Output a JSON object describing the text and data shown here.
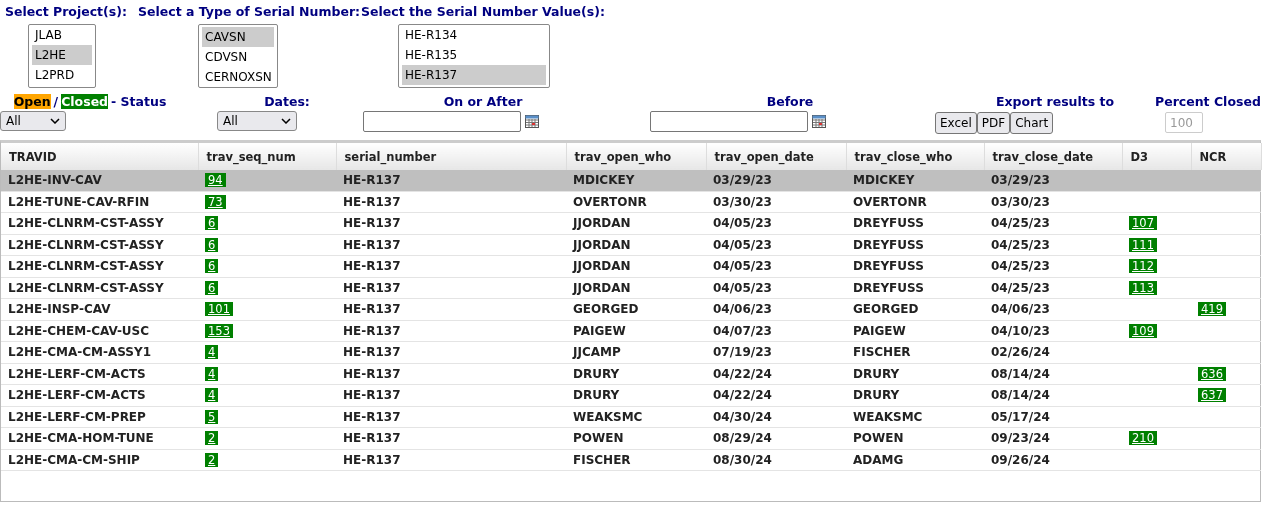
{
  "selectors": [
    {
      "label": "Select Project(s):",
      "items": [
        {
          "text": "JLAB",
          "selected": false
        },
        {
          "text": "L2HE",
          "selected": true
        },
        {
          "text": "L2PRD",
          "selected": false
        }
      ]
    },
    {
      "label": "Select a Type of Serial Number:",
      "items": [
        {
          "text": "CAVSN",
          "selected": true
        },
        {
          "text": "CDVSN",
          "selected": false
        },
        {
          "text": "CERNOXSN",
          "selected": false
        }
      ]
    },
    {
      "label": "Select the Serial Number Value(s):",
      "items": [
        {
          "text": "HE-R134",
          "selected": false
        },
        {
          "text": "HE-R135",
          "selected": false
        },
        {
          "text": "HE-R137",
          "selected": true
        }
      ]
    }
  ],
  "status": {
    "open": "Open",
    "slash": "/",
    "closed": "Closed",
    "suffix": "- Status",
    "value": "All"
  },
  "dates": {
    "label": "Dates:",
    "value": "All"
  },
  "on_or_after": {
    "label": "On or After"
  },
  "before": {
    "label": "Before"
  },
  "export": {
    "label": "Export results to",
    "buttons": [
      "Excel",
      "PDF",
      "Chart"
    ]
  },
  "percent_closed": {
    "label": "Percent Closed",
    "value": "100",
    "disabled": true
  },
  "table": {
    "columns": [
      "TRAVID",
      "trav_seq_num",
      "serial_number",
      "trav_open_who",
      "trav_open_date",
      "trav_close_who",
      "trav_close_date",
      "D3",
      "NCR"
    ],
    "rows": [
      {
        "selected": true,
        "travid": "L2HE-INV-CAV",
        "seq": "94",
        "serial": "HE-R137",
        "open_who": "MDICKEY",
        "open_date": "03/29/23",
        "close_who": "MDICKEY",
        "close_date": "03/29/23"
      },
      {
        "selected": false,
        "travid": "L2HE-TUNE-CAV-RFIN",
        "seq": "73",
        "serial": "HE-R137",
        "open_who": "OVERTONR",
        "open_date": "03/30/23",
        "close_who": "OVERTONR",
        "close_date": "03/30/23"
      },
      {
        "selected": false,
        "travid": "L2HE-CLNRM-CST-ASSY",
        "seq": "6",
        "serial": "HE-R137",
        "open_who": "JJORDAN",
        "open_date": "04/05/23",
        "close_who": "DREYFUSS",
        "close_date": "04/25/23",
        "d3": "107"
      },
      {
        "selected": false,
        "travid": "L2HE-CLNRM-CST-ASSY",
        "seq": "6",
        "serial": "HE-R137",
        "open_who": "JJORDAN",
        "open_date": "04/05/23",
        "close_who": "DREYFUSS",
        "close_date": "04/25/23",
        "d3": "111"
      },
      {
        "selected": false,
        "travid": "L2HE-CLNRM-CST-ASSY",
        "seq": "6",
        "serial": "HE-R137",
        "open_who": "JJORDAN",
        "open_date": "04/05/23",
        "close_who": "DREYFUSS",
        "close_date": "04/25/23",
        "d3": "112"
      },
      {
        "selected": false,
        "travid": "L2HE-CLNRM-CST-ASSY",
        "seq": "6",
        "serial": "HE-R137",
        "open_who": "JJORDAN",
        "open_date": "04/05/23",
        "close_who": "DREYFUSS",
        "close_date": "04/25/23",
        "d3": "113"
      },
      {
        "selected": false,
        "travid": "L2HE-INSP-CAV",
        "seq": "101",
        "serial": "HE-R137",
        "open_who": "GEORGED",
        "open_date": "04/06/23",
        "close_who": "GEORGED",
        "close_date": "04/06/23",
        "ncr": "419"
      },
      {
        "selected": false,
        "travid": "L2HE-CHEM-CAV-USC",
        "seq": "153",
        "serial": "HE-R137",
        "open_who": "PAIGEW",
        "open_date": "04/07/23",
        "close_who": "PAIGEW",
        "close_date": "04/10/23",
        "d3": "109"
      },
      {
        "selected": false,
        "travid": "L2HE-CMA-CM-ASSY1",
        "seq": "4",
        "serial": "HE-R137",
        "open_who": "JJCAMP",
        "open_date": "07/19/23",
        "close_who": "FISCHER",
        "close_date": "02/26/24"
      },
      {
        "selected": false,
        "travid": "L2HE-LERF-CM-ACTS",
        "seq": "4",
        "serial": "HE-R137",
        "open_who": "DRURY",
        "open_date": "04/22/24",
        "close_who": "DRURY",
        "close_date": "08/14/24",
        "ncr": "636"
      },
      {
        "selected": false,
        "travid": "L2HE-LERF-CM-ACTS",
        "seq": "4",
        "serial": "HE-R137",
        "open_who": "DRURY",
        "open_date": "04/22/24",
        "close_who": "DRURY",
        "close_date": "08/14/24",
        "ncr": "637"
      },
      {
        "selected": false,
        "travid": "L2HE-LERF-CM-PREP",
        "seq": "5",
        "serial": "HE-R137",
        "open_who": "WEAKSMC",
        "open_date": "04/30/24",
        "close_who": "WEAKSMC",
        "close_date": "05/17/24"
      },
      {
        "selected": false,
        "travid": "L2HE-CMA-HOM-TUNE",
        "seq": "2",
        "serial": "HE-R137",
        "open_who": "POWEN",
        "open_date": "08/29/24",
        "close_who": "POWEN",
        "close_date": "09/23/24",
        "d3": "210"
      },
      {
        "selected": false,
        "travid": "L2HE-CMA-CM-SHIP",
        "seq": "2",
        "serial": "HE-R137",
        "open_who": "FISCHER",
        "open_date": "08/30/24",
        "close_who": "ADAMG",
        "close_date": "09/26/24"
      }
    ]
  }
}
